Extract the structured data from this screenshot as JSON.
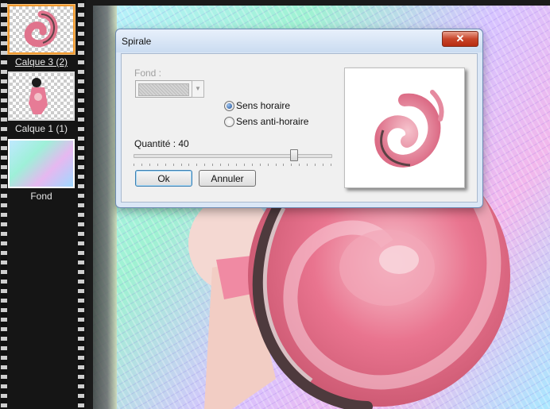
{
  "layers": [
    {
      "label": "Calque 3 (2)",
      "selected": true
    },
    {
      "label": "Calque 1 (1)",
      "selected": false
    },
    {
      "label": "Fond",
      "selected": false
    }
  ],
  "dialog": {
    "title": "Spirale",
    "close_label": "✕",
    "fond_label": "Fond :",
    "radio_clockwise": "Sens horaire",
    "radio_counter": "Sens anti-horaire",
    "quantity_label": "Quantité : 40",
    "quantity_value": 40,
    "ok_label": "Ok",
    "cancel_label": "Annuler"
  },
  "colors": {
    "selected_layer_border": "#f29a2e",
    "spiral_pink": "#e9748f",
    "spiral_dark": "#5a4245"
  }
}
